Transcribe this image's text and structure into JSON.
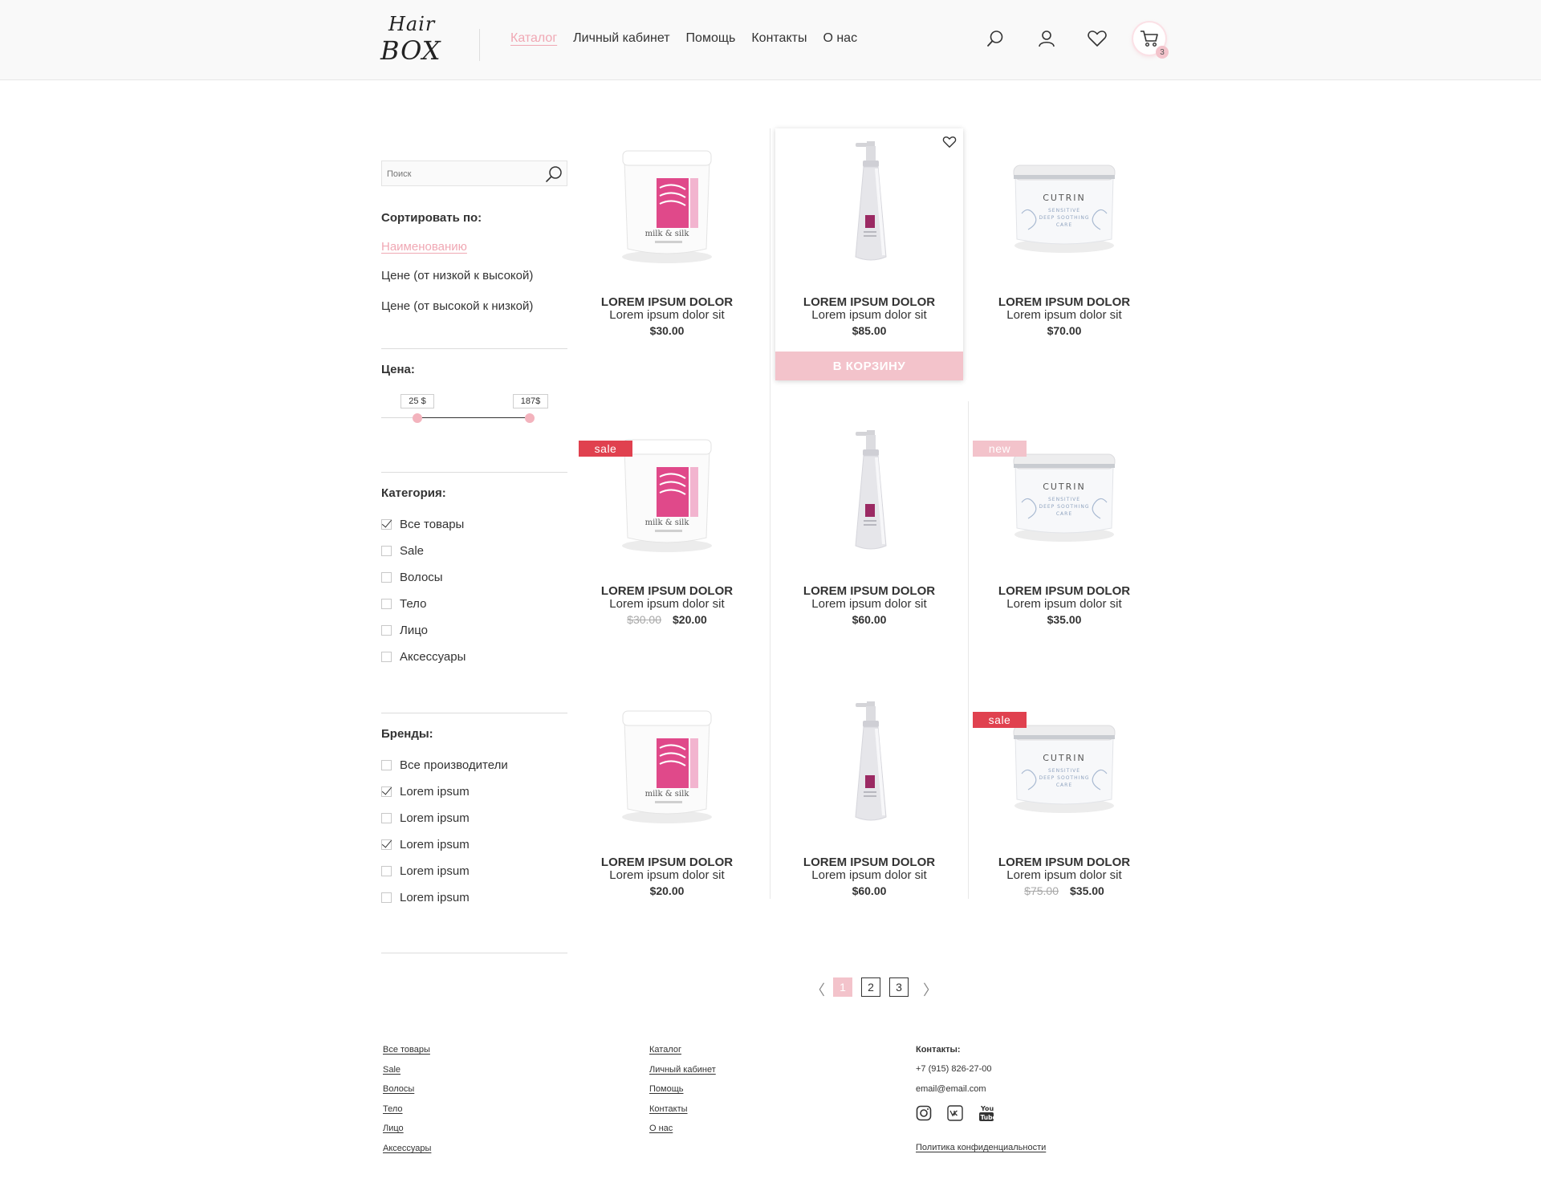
{
  "header": {
    "logo_line1": "Hair",
    "logo_line2": "BOX",
    "nav": [
      "Каталог",
      "Личный кабинет",
      "Помощь",
      "Контакты",
      "О нас"
    ],
    "cart_count": "3"
  },
  "sidebar": {
    "search_placeholder": "Поиск",
    "sort_title": "Сортировать по:",
    "sort_options": [
      "Наименованию",
      "Цене (от низкой к высокой)",
      "Цене (от высокой к низкой)"
    ],
    "price_title": "Цена:",
    "price_min": "25 $",
    "price_max": "187$",
    "category_title": "Категория:",
    "categories": [
      {
        "label": "Все товары",
        "checked": true
      },
      {
        "label": "Sale",
        "checked": false
      },
      {
        "label": "Волосы",
        "checked": false
      },
      {
        "label": "Тело",
        "checked": false
      },
      {
        "label": "Лицо",
        "checked": false
      },
      {
        "label": "Аксессуары",
        "checked": false
      }
    ],
    "brands_title": "Бренды:",
    "brands": [
      {
        "label": "Все производители",
        "checked": false
      },
      {
        "label": "Lorem ipsum",
        "checked": true
      },
      {
        "label": "Lorem ipsum",
        "checked": false
      },
      {
        "label": "Lorem ipsum",
        "checked": true
      },
      {
        "label": "Lorem ipsum",
        "checked": false
      },
      {
        "label": "Lorem ipsum",
        "checked": false
      }
    ]
  },
  "products": [
    {
      "name": "LOREM IPSUM DOLOR",
      "desc": "Lorem ipsum dolor sit",
      "price": "$30.00",
      "old_price": "",
      "badge": "",
      "image": "cream-jar"
    },
    {
      "name": "LOREM IPSUM DOLOR",
      "desc": "Lorem ipsum dolor sit",
      "price": "$85.00",
      "old_price": "",
      "badge": "",
      "image": "pump-bottle",
      "cart_label": "В КОРЗИНУ"
    },
    {
      "name": "LOREM IPSUM DOLOR",
      "desc": "Lorem ipsum dolor sit",
      "price": "$70.00",
      "old_price": "",
      "badge": "",
      "image": "cutrin-jar"
    },
    {
      "name": "LOREM IPSUM DOLOR",
      "desc": "Lorem ipsum dolor sit",
      "price": "$20.00",
      "old_price": "$30.00",
      "badge": "sale",
      "image": "cream-jar"
    },
    {
      "name": "LOREM IPSUM DOLOR",
      "desc": "Lorem ipsum dolor sit",
      "price": "$60.00",
      "old_price": "",
      "badge": "",
      "image": "pump-bottle"
    },
    {
      "name": "LOREM IPSUM DOLOR",
      "desc": "Lorem ipsum dolor sit",
      "price": "$35.00",
      "old_price": "",
      "badge": "new",
      "image": "cutrin-jar"
    },
    {
      "name": "LOREM IPSUM DOLOR",
      "desc": "Lorem ipsum dolor sit",
      "price": "$20.00",
      "old_price": "",
      "badge": "",
      "image": "cream-jar"
    },
    {
      "name": "LOREM IPSUM DOLOR",
      "desc": "Lorem ipsum dolor sit",
      "price": "$60.00",
      "old_price": "",
      "badge": "",
      "image": "pump-bottle"
    },
    {
      "name": "LOREM IPSUM DOLOR",
      "desc": "Lorem ipsum dolor sit",
      "price": "$35.00",
      "old_price": "$75.00",
      "badge": "sale",
      "image": "cutrin-jar"
    }
  ],
  "pagination": {
    "prev": "〈",
    "pages": [
      "1",
      "2",
      "3"
    ],
    "next": "〉"
  },
  "footer": {
    "col1": [
      "Все товары",
      "Sale",
      "Волосы",
      "Тело",
      "Лицо",
      "Аксессуары"
    ],
    "col2": [
      "Каталог",
      "Личный кабинет",
      "Помощь",
      "Контакты",
      "О нас"
    ],
    "contacts_title": "Контакты:",
    "phone": "+7 (915) 826-27-00",
    "email": "email@email.com",
    "privacy": "Политика конфиденциальности"
  },
  "colors": {
    "accent": "#f3c3cb",
    "sale": "#e0414f",
    "text": "#333333"
  }
}
